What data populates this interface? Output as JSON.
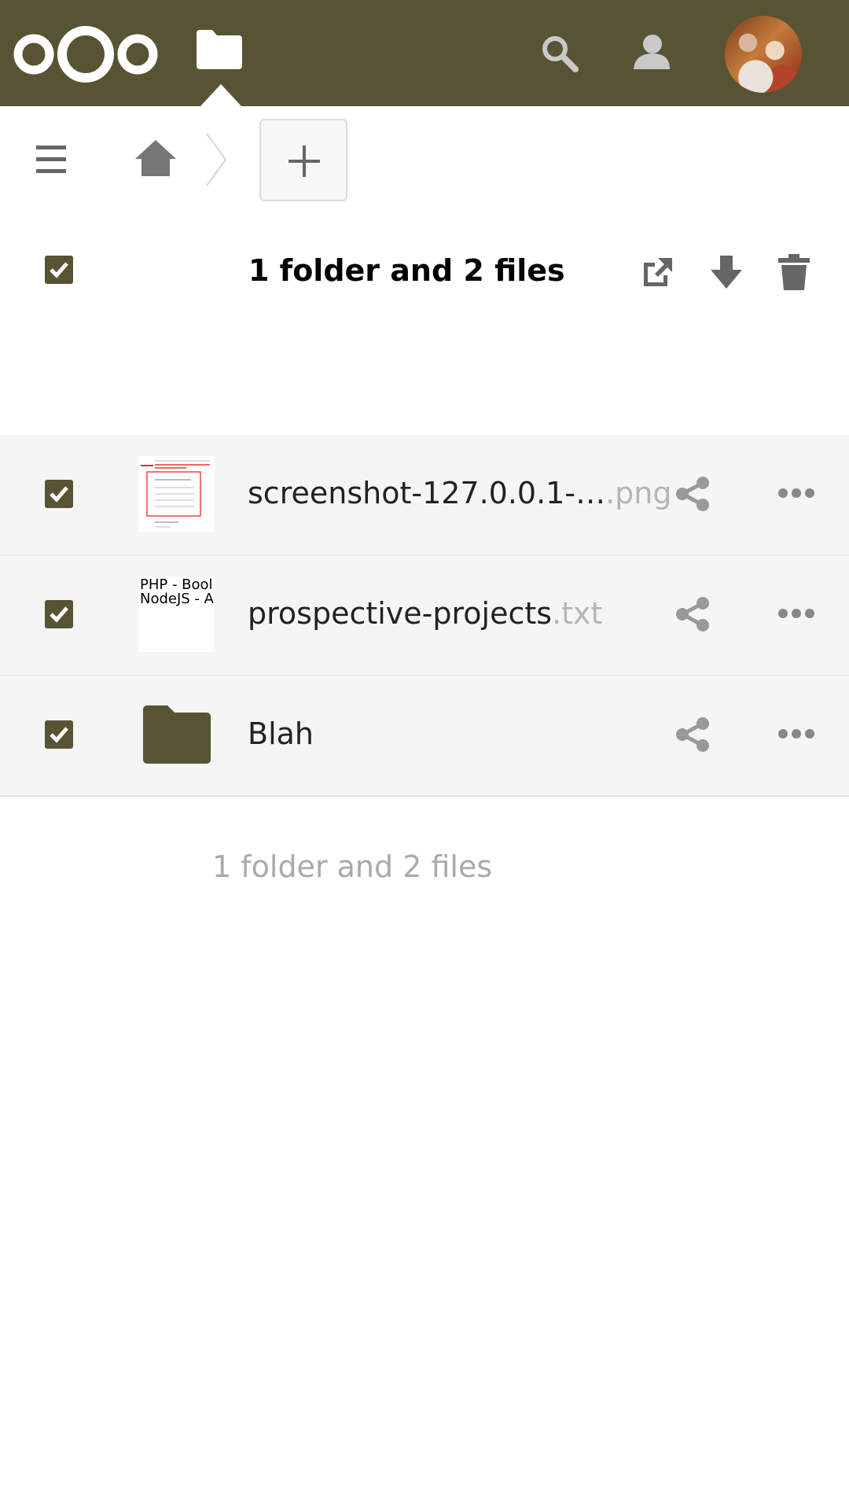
{
  "header": {
    "brand": "Nextcloud",
    "active_app": "Files",
    "accent_color": "#575434",
    "icons": [
      "nextcloud-logo",
      "files-folder-icon",
      "search-icon",
      "contacts-icon",
      "user-avatar"
    ]
  },
  "controls": {
    "menu_icon": "hamburger-menu-icon",
    "home_icon": "home-icon",
    "new_icon": "plus-icon"
  },
  "selection": {
    "summary": "1 folder and 2 files",
    "actions": [
      "share-open-icon",
      "download-icon",
      "trash-icon"
    ]
  },
  "files": [
    {
      "name": "screenshot-127.0.0.1-…",
      "ext": ".png",
      "selected": true,
      "type": "image"
    },
    {
      "name": "prospective-projects",
      "ext": ".txt",
      "selected": true,
      "type": "text",
      "thumb_text": "PHP - Bool\nNodeJS - A"
    },
    {
      "name": "Blah",
      "ext": "",
      "selected": true,
      "type": "folder"
    }
  ],
  "footer": {
    "summary": "1 folder and 2 files"
  }
}
